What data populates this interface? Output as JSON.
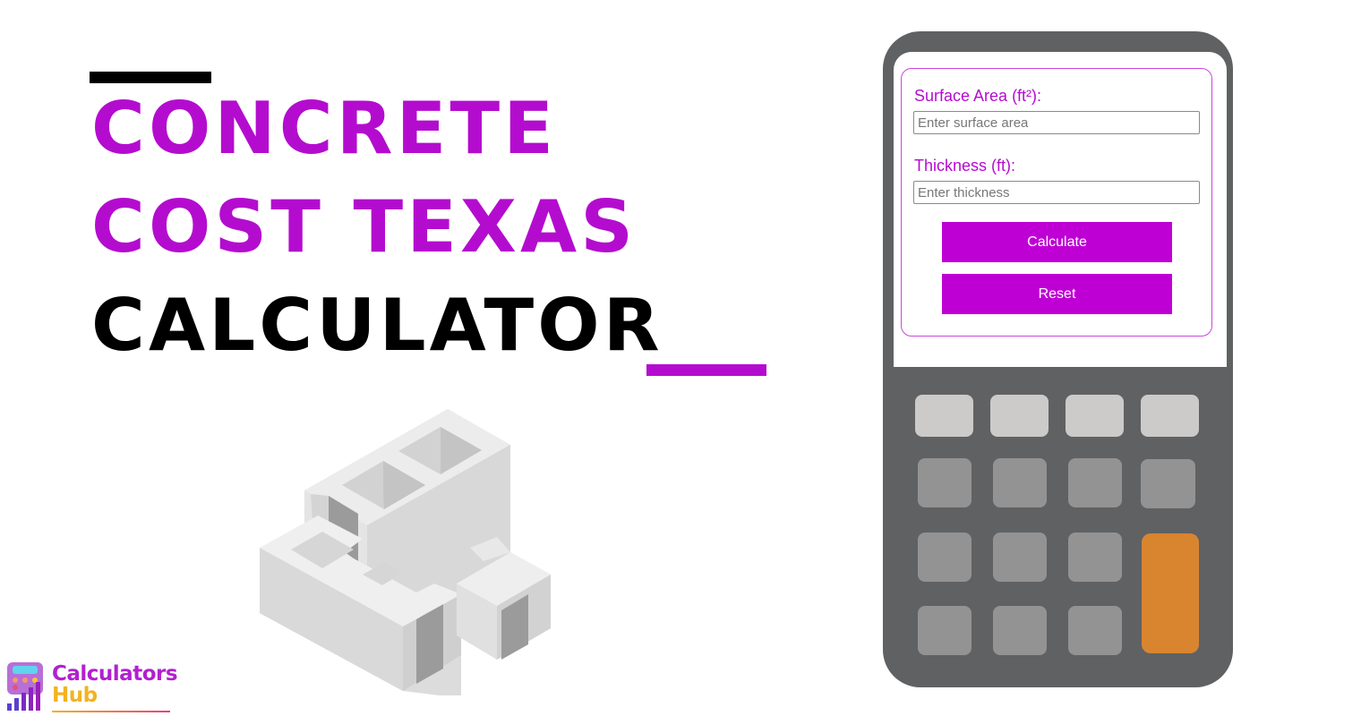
{
  "colors": {
    "accent": "#b40ccf",
    "button": "#bf00d5",
    "calculator_body": "#606163",
    "key_light": "#cccbc9",
    "key_mid": "#939393",
    "key_orange": "#d98530"
  },
  "title": {
    "line1": "CONCRETE",
    "line2": "COST TEXAS",
    "line3": "CALCULATOR"
  },
  "form": {
    "surface_area": {
      "label": "Surface Area (ft²):",
      "value": "",
      "placeholder": "Enter surface area"
    },
    "thickness": {
      "label": "Thickness (ft):",
      "value": "",
      "placeholder": "Enter thickness"
    },
    "calculate_label": "Calculate",
    "reset_label": "Reset"
  },
  "illustration": {
    "icon": "concrete-blocks-icon"
  },
  "logo": {
    "line1": "Calculators",
    "line2": "Hub",
    "icon": "calculator-chart-icon"
  }
}
